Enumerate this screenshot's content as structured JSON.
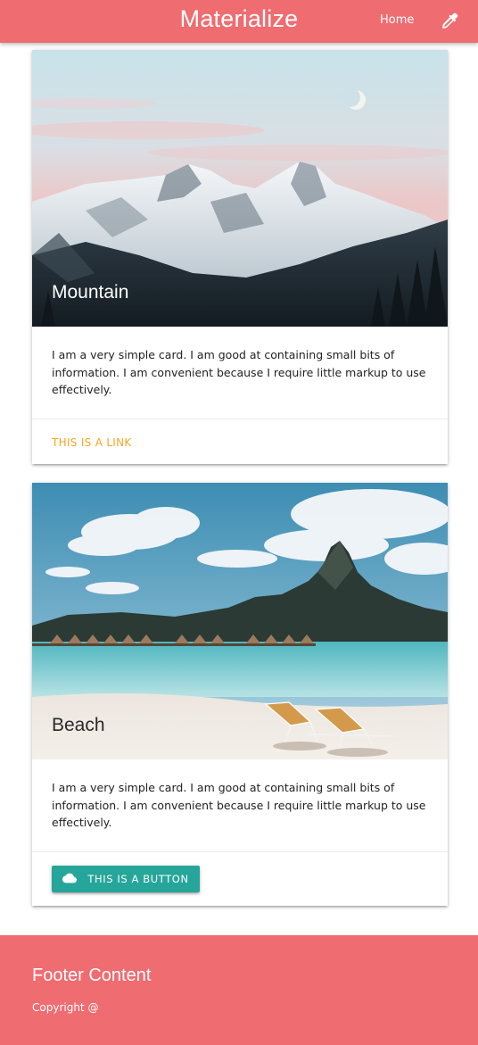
{
  "navbar": {
    "brand": "Materialize",
    "home_label": "Home",
    "icon": "pipette-icon",
    "color": "#ef6c71"
  },
  "cards": [
    {
      "title": "Mountain",
      "content": "I am a very simple card. I am good at containing small bits of information. I am convenient because I require little markup to use effectively.",
      "action_label": "THIS IS A LINK",
      "action_color": "#f6a623"
    },
    {
      "title": "Beach",
      "content": "I am a very simple card. I am good at containing small bits of information. I am convenient because I require little markup to use effectively.",
      "action_label": "THIS IS A BUTTON",
      "action_icon": "cloud-icon",
      "action_color": "#26a69a"
    }
  ],
  "footer": {
    "title": "Footer Content",
    "copyright": "Copyright @"
  }
}
